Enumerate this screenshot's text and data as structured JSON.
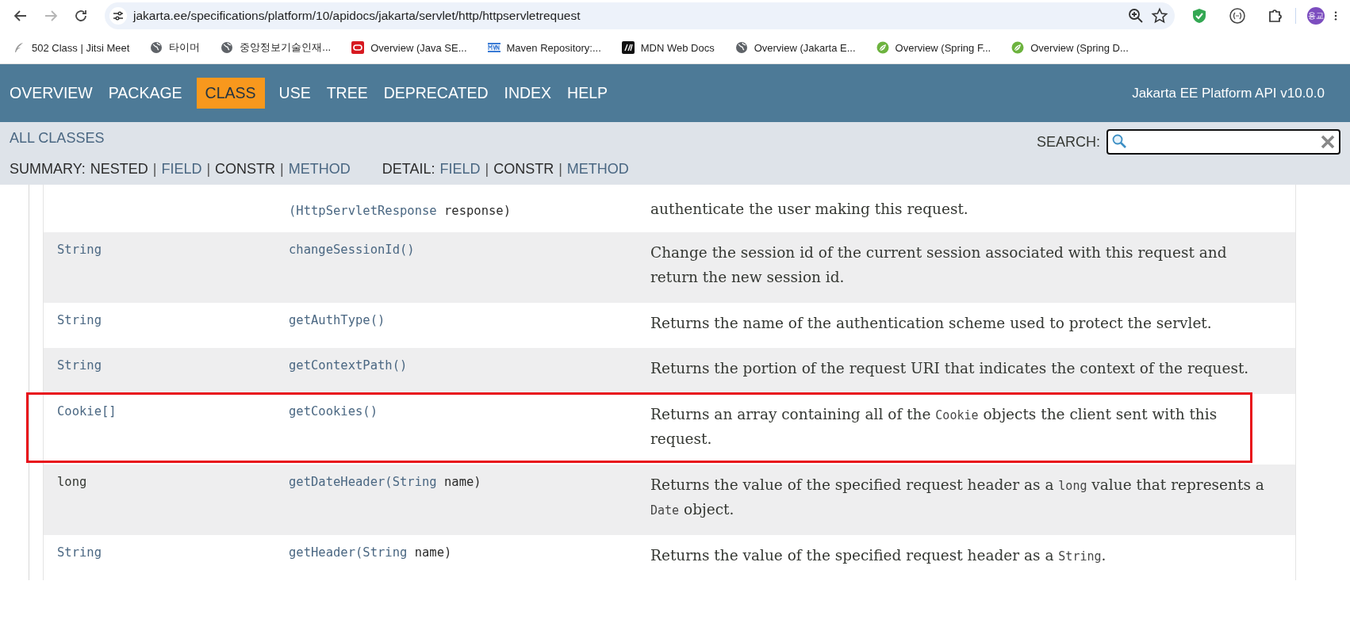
{
  "browser": {
    "url": "jakarta.ee/specifications/platform/10/apidocs/jakarta/servlet/http/httpservletrequest",
    "forward_disabled": true,
    "profile": "용교"
  },
  "bookmarks": [
    {
      "label": "502 Class | Jitsi Meet",
      "kind": "feather"
    },
    {
      "label": "타이머",
      "kind": "globe"
    },
    {
      "label": "중앙정보기술인재...",
      "kind": "globe"
    },
    {
      "label": "Overview (Java SE...",
      "kind": "oracle"
    },
    {
      "label": "Maven Repository:...",
      "kind": "maven"
    },
    {
      "label": "MDN Web Docs",
      "kind": "mdn"
    },
    {
      "label": "Overview (Jakarta E...",
      "kind": "globe"
    },
    {
      "label": "Overview (Spring F...",
      "kind": "spring"
    },
    {
      "label": "Overview (Spring D...",
      "kind": "spring"
    }
  ],
  "nav": {
    "items": [
      {
        "label": "OVERVIEW",
        "selected": false
      },
      {
        "label": "PACKAGE",
        "selected": false
      },
      {
        "label": "CLASS",
        "selected": true
      },
      {
        "label": "USE",
        "selected": false
      },
      {
        "label": "TREE",
        "selected": false
      },
      {
        "label": "DEPRECATED",
        "selected": false
      },
      {
        "label": "INDEX",
        "selected": false
      },
      {
        "label": "HELP",
        "selected": false
      }
    ],
    "title": "Jakarta EE Platform API v10.0.0"
  },
  "subnav": {
    "all_classes": "ALL CLASSES",
    "search_label": "SEARCH:",
    "summary": [
      {
        "text": "SUMMARY:",
        "kind": "label"
      },
      {
        "text": "NESTED",
        "kind": "plain"
      },
      {
        "text": "|",
        "kind": "sep"
      },
      {
        "text": "FIELD",
        "kind": "link"
      },
      {
        "text": "|",
        "kind": "sep"
      },
      {
        "text": "CONSTR",
        "kind": "plain"
      },
      {
        "text": "|",
        "kind": "sep"
      },
      {
        "text": "METHOD",
        "kind": "link"
      }
    ],
    "detail": [
      {
        "text": "DETAIL:",
        "kind": "label"
      },
      {
        "text": "FIELD",
        "kind": "link"
      },
      {
        "text": "|",
        "kind": "sep"
      },
      {
        "text": "CONSTR",
        "kind": "plain"
      },
      {
        "text": "|",
        "kind": "sep"
      },
      {
        "text": "METHOD",
        "kind": "link"
      }
    ]
  },
  "methods": [
    {
      "highlighted": false,
      "method": [
        {
          "text": "(HttpServletResponse",
          "kind": "link"
        },
        {
          "text": " response)",
          "kind": "plain"
        }
      ],
      "description": [
        {
          "text": "authenticate the user making this request.",
          "kind": "text"
        }
      ]
    },
    {
      "highlighted": false,
      "type": "String",
      "type_link": true,
      "method": [
        {
          "text": "changeSessionId()",
          "kind": "link"
        }
      ],
      "description": [
        {
          "text": "Change the session id of the current session associated with this request and return the new session id.",
          "kind": "text"
        }
      ]
    },
    {
      "highlighted": false,
      "type": "String",
      "type_link": true,
      "method": [
        {
          "text": "getAuthType()",
          "kind": "link"
        }
      ],
      "description": [
        {
          "text": "Returns the name of the authentication scheme used to protect the servlet.",
          "kind": "text"
        }
      ]
    },
    {
      "highlighted": false,
      "type": "String",
      "type_link": true,
      "method": [
        {
          "text": "getContextPath()",
          "kind": "link"
        }
      ],
      "description": [
        {
          "text": "Returns the portion of the request URI that indicates the context of the request.",
          "kind": "text"
        }
      ]
    },
    {
      "highlighted": true,
      "type": "Cookie[]",
      "type_link": true,
      "method": [
        {
          "text": "getCookies()",
          "kind": "link"
        }
      ],
      "description": [
        {
          "text": "Returns an array containing all of the ",
          "kind": "text"
        },
        {
          "text": "Cookie",
          "kind": "code"
        },
        {
          "text": " objects the client sent with this request.",
          "kind": "text"
        }
      ]
    },
    {
      "highlighted": false,
      "type": "long",
      "type_link": false,
      "method": [
        {
          "text": "getDateHeader(String",
          "kind": "link"
        },
        {
          "text": " name)",
          "kind": "plain"
        }
      ],
      "description": [
        {
          "text": "Returns the value of the specified request header as a ",
          "kind": "text"
        },
        {
          "text": "long",
          "kind": "code"
        },
        {
          "text": " value that represents a ",
          "kind": "text"
        },
        {
          "text": "Date",
          "kind": "code"
        },
        {
          "text": " object.",
          "kind": "text"
        }
      ]
    },
    {
      "highlighted": false,
      "type": "String",
      "type_link": true,
      "method": [
        {
          "text": "getHeader(String",
          "kind": "link"
        },
        {
          "text": " name)",
          "kind": "plain"
        }
      ],
      "description": [
        {
          "text": "Returns the value of the specified request header as a ",
          "kind": "text"
        },
        {
          "text": "String",
          "kind": "code"
        },
        {
          "text": ".",
          "kind": "text"
        }
      ]
    }
  ]
}
